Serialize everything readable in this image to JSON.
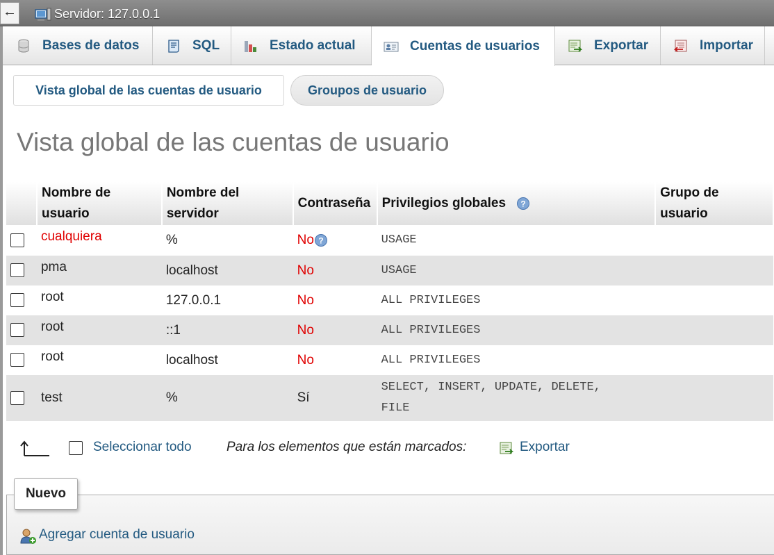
{
  "topbar": {
    "back_label": "←",
    "server_label": "Servidor: 127.0.0.1"
  },
  "tabs": [
    {
      "label": "Bases de datos",
      "icon": "database-icon"
    },
    {
      "label": "SQL",
      "icon": "sql-icon"
    },
    {
      "label": "Estado actual",
      "icon": "status-icon"
    },
    {
      "label": "Cuentas de usuarios",
      "icon": "user-accounts-icon",
      "active": true
    },
    {
      "label": "Exportar",
      "icon": "export-icon"
    },
    {
      "label": "Importar",
      "icon": "import-icon"
    }
  ],
  "subtabs": [
    {
      "label": "Vista global de las cuentas de usuario"
    },
    {
      "label": "Groupos de usuario"
    }
  ],
  "page_title": "Vista global de las cuentas de usuario",
  "table": {
    "headers": {
      "user_1": "Nombre de",
      "user_2": "usuario",
      "host_1": "Nombre del",
      "host_2": "servidor",
      "password": "Contraseña",
      "privileges": "Privilegios globales",
      "group_1": "Grupo de",
      "group_2": "usuario"
    },
    "rows": [
      {
        "user": "cualquiera",
        "host": "%",
        "password": "No",
        "privileges": "USAGE",
        "privileges_2": ""
      },
      {
        "user": "pma",
        "host": "localhost",
        "password": "No",
        "privileges": "USAGE",
        "privileges_2": ""
      },
      {
        "user": "root",
        "host": "127.0.0.1",
        "password": "No",
        "privileges": "ALL PRIVILEGES",
        "privileges_2": ""
      },
      {
        "user": "root",
        "host": "::1",
        "password": "No",
        "privileges": "ALL PRIVILEGES",
        "privileges_2": ""
      },
      {
        "user": "root",
        "host": "localhost",
        "password": "No",
        "privileges": "ALL PRIVILEGES",
        "privileges_2": ""
      },
      {
        "user": "test",
        "host": "%",
        "password": "Sí",
        "privileges": "SELECT, INSERT, UPDATE, DELETE,",
        "privileges_2": "FILE"
      }
    ]
  },
  "footer": {
    "select_all": "Seleccionar todo",
    "marked_label": "Para los elementos que están marcados:",
    "export_label": "Exportar"
  },
  "nuevo": {
    "legend": "Nuevo",
    "add_user": "Agregar cuenta de usuario"
  },
  "colors": {
    "link": "#235a81",
    "red": "#e00000",
    "title": "#777777"
  }
}
